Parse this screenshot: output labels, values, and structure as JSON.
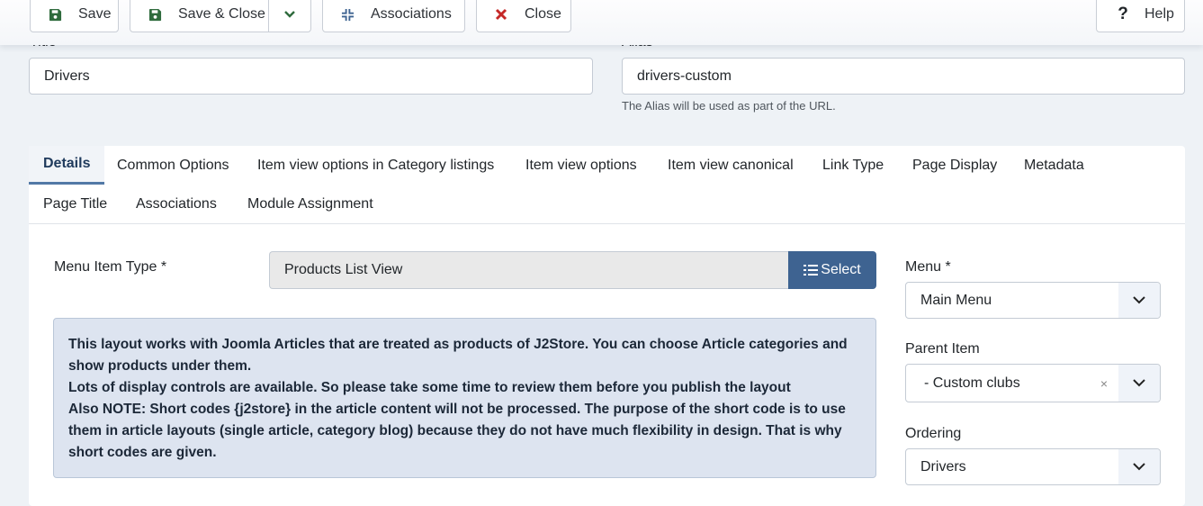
{
  "toolbar": {
    "save": "Save",
    "save_close": "Save & Close",
    "associations": "Associations",
    "close": "Close",
    "help": "Help",
    "colors": {
      "save_icon": "#2f6b3d",
      "close_icon": "#c52827",
      "assoc_icon": "#3e6391"
    }
  },
  "form": {
    "title_label": "Title",
    "title_value": "Drivers",
    "alias_label": "Alias",
    "alias_value": "drivers-custom",
    "alias_hint": "The Alias will be used as part of the URL."
  },
  "tabs": [
    {
      "label": "Details",
      "active": true
    },
    {
      "label": "Common Options"
    },
    {
      "label": "Item view options in Category listings"
    },
    {
      "label": "Item view options"
    },
    {
      "label": "Item view canonical"
    },
    {
      "label": "Link Type"
    },
    {
      "label": "Page Display"
    },
    {
      "label": "Metadata"
    },
    {
      "label": "Page Title"
    },
    {
      "label": "Associations"
    },
    {
      "label": "Module Assignment"
    }
  ],
  "details": {
    "menu_item_type_label": "Menu Item Type *",
    "menu_item_type_value": "Products List View",
    "select_button": "Select",
    "notice": [
      "This layout works with Joomla Articles that are treated as products of J2Store. You can choose Article categories and show products under them.",
      "Lots of display controls are available. So please take some time to review them before you publish the layout",
      "Also NOTE: Short codes {j2store} in the article content will not be processed. The purpose of the short code is to use them in article layouts (single article, category blog) because they do not have much flexibility in design. That is why short codes are given."
    ]
  },
  "sidebar": {
    "menu_label": "Menu *",
    "menu_value": "Main Menu",
    "parent_label": "Parent Item",
    "parent_value": "- Custom clubs",
    "parent_clear": "×",
    "ordering_label": "Ordering",
    "ordering_value": "Drivers"
  }
}
